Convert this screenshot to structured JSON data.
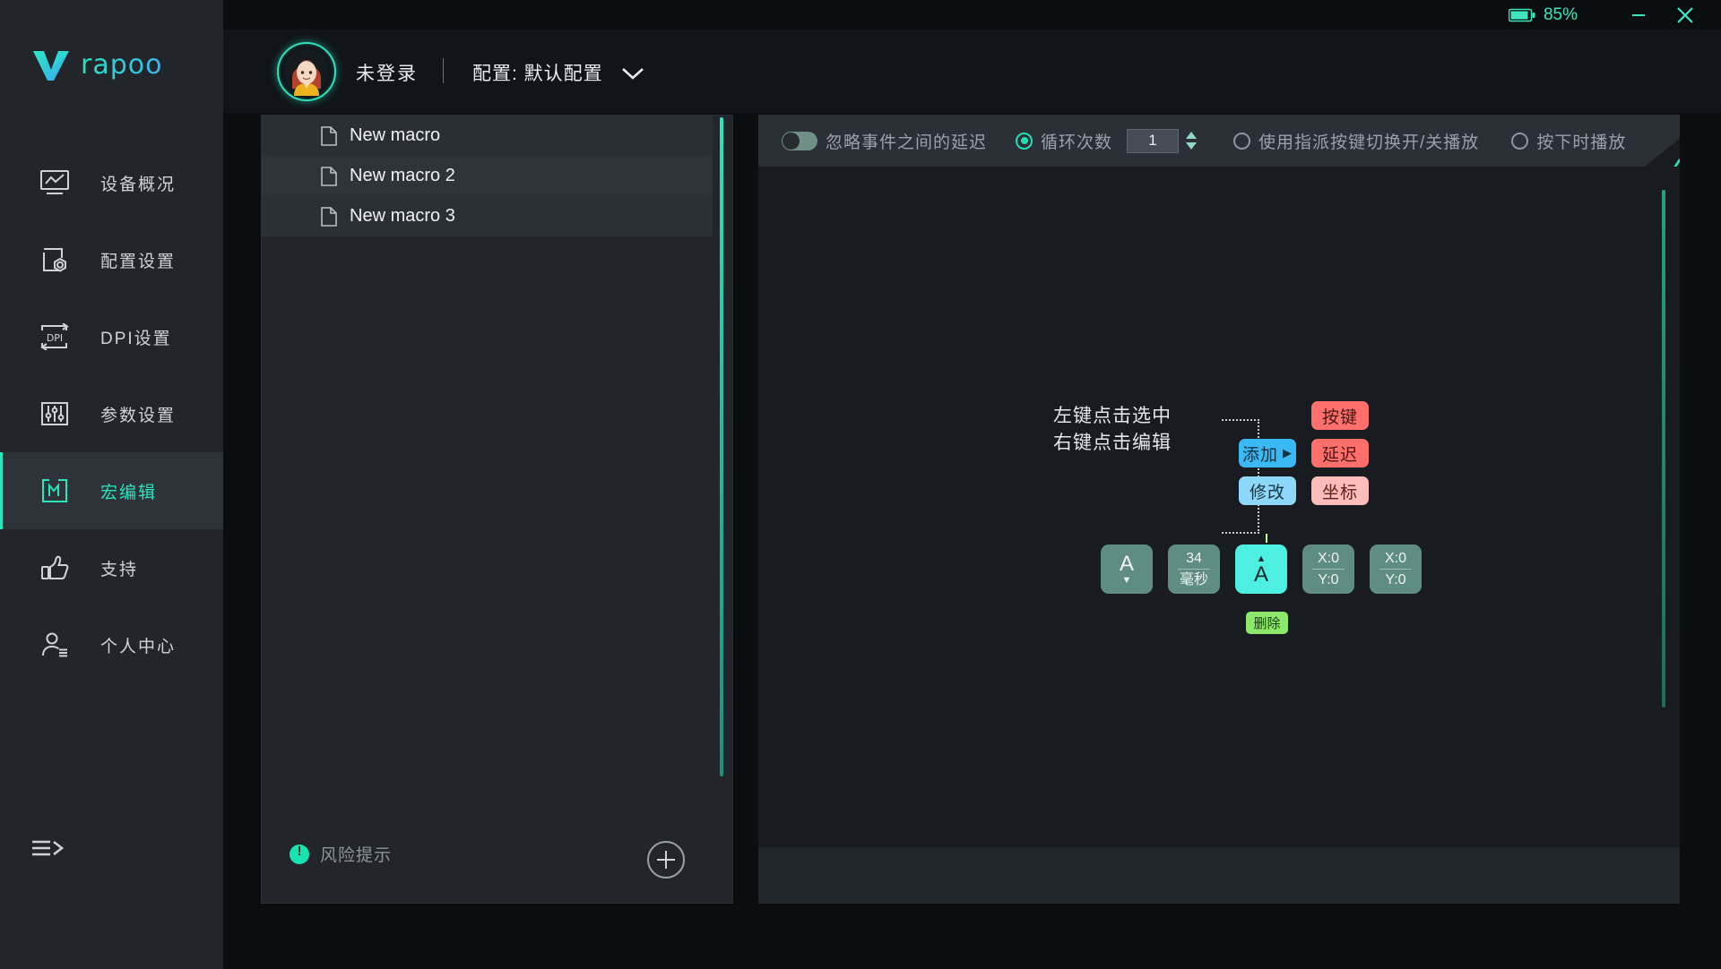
{
  "brand": {
    "name": "rapoo",
    "logo_icon": "rapoo-v-logo"
  },
  "titlebar": {
    "battery_percent": "85%",
    "battery_icon": "battery-icon",
    "minimize_label": "—",
    "close_label": "✕"
  },
  "header": {
    "avatar_icon": "user-avatar",
    "login_status": "未登录",
    "divider": "|",
    "profile_label": "配置: 默认配置",
    "chevron_icon": "chevron-down-icon"
  },
  "sidebar": {
    "items": [
      {
        "label": "设备概况",
        "icon": "device-overview-icon",
        "active": false
      },
      {
        "label": "配置设置",
        "icon": "config-settings-icon",
        "active": false
      },
      {
        "label": "DPI设置",
        "icon": "dpi-settings-icon",
        "active": false
      },
      {
        "label": "参数设置",
        "icon": "parameter-settings-icon",
        "active": false
      },
      {
        "label": "宏编辑",
        "icon": "macro-editor-icon",
        "active": true
      },
      {
        "label": "支持",
        "icon": "support-thumbs-up-icon",
        "active": false
      },
      {
        "label": "个人中心",
        "icon": "user-center-icon",
        "active": false
      }
    ],
    "collapse_icon": "menu-expand-icon"
  },
  "macro_panel": {
    "items": [
      {
        "name": "New macro",
        "icon": "file-icon"
      },
      {
        "name": "New macro 2",
        "icon": "file-icon"
      },
      {
        "name": "New macro 3",
        "icon": "file-icon"
      }
    ],
    "risk_label": "风险提示",
    "risk_icon": "warning-circle-icon",
    "add_button_icon": "plus-icon"
  },
  "toolbar": {
    "ignore_delay_label": "忽略事件之间的延迟",
    "ignore_delay_on": false,
    "loop_count_label": "循环次数",
    "loop_count_value": "1",
    "loop_count_selected": true,
    "toggle_play_label": "使用指派按键切换开/关播放",
    "toggle_play_selected": false,
    "press_play_label": "按下时播放",
    "press_play_selected": false
  },
  "hint": {
    "line1": "左键点击选中",
    "line2": "右键点击编辑",
    "add_label": "添加",
    "add_arrow": "▶",
    "modify_label": "修改",
    "key_label": "按键",
    "delay_label": "延迟",
    "coord_label": "坐标"
  },
  "events": {
    "delete_label": "删除",
    "items": [
      {
        "type": "key-release",
        "key": "A",
        "marker": "▼",
        "highlighted": false
      },
      {
        "type": "delay",
        "top": "34",
        "bottom": "毫秒",
        "highlighted": false
      },
      {
        "type": "key-press",
        "key": "A",
        "marker": "▲",
        "highlighted": true
      },
      {
        "type": "coordinate",
        "top": "X:0",
        "bottom": "Y:0",
        "highlighted": false
      },
      {
        "type": "coordinate",
        "top": "X:0",
        "bottom": "Y:0",
        "highlighted": false
      }
    ]
  },
  "colors": {
    "accent_teal": "#29e6bd",
    "add_blue": "#3bb9f5",
    "modify_blue": "#8dd8fa",
    "key_red": "#ff6f6b",
    "coord_pink": "#ffbcb8",
    "delete_green": "#8ce86a",
    "event_teal": "#5f8c83",
    "event_highlight": "#4df0e0"
  }
}
